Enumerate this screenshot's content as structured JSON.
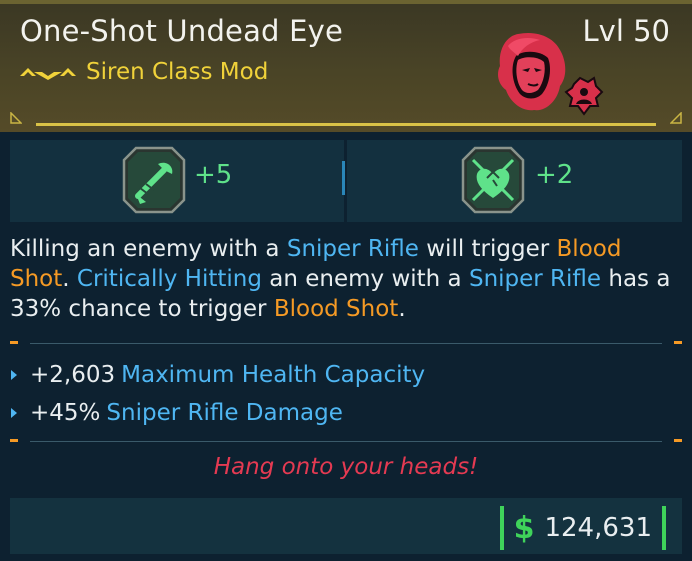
{
  "item": {
    "name": "One-Shot Undead Eye",
    "level": "Lvl 50",
    "type": "Siren Class Mod",
    "rarity_icon": "legendary-chevrons-icon",
    "portrait_icon": "siren-portrait-icon",
    "accent_color": "#d9c247"
  },
  "skills": [
    {
      "icon": "sniper-rifle-skill-icon",
      "bonus": "+5"
    },
    {
      "icon": "heart-cross-skill-icon",
      "bonus": "+2"
    }
  ],
  "description": {
    "p1": "Killing an enemy with a ",
    "k1": "Sniper Rifle",
    "p2": " will trigger ",
    "k2": "Blood Shot",
    "p3": ". ",
    "k3": "Critically Hitting",
    "p4": " an enemy with a ",
    "k4": "Sniper Rifle",
    "p5": " has a 33% chance to trigger ",
    "k5": "Blood Shot",
    "p6": "."
  },
  "stats": [
    {
      "value": "+2,603",
      "name": "Maximum Health Capacity"
    },
    {
      "value": "+45%",
      "name": "Sniper Rifle Damage"
    }
  ],
  "flavor_text": "Hang onto your heads!",
  "price": {
    "currency_icon": "dollar-icon",
    "symbol": "$",
    "amount": "124,631"
  },
  "colors": {
    "keyword_blue": "#4fb6f2",
    "keyword_orange": "#f59a25",
    "flavor_red": "#e43a52",
    "price_green": "#3fd35a",
    "skill_green": "#5fe28a"
  }
}
